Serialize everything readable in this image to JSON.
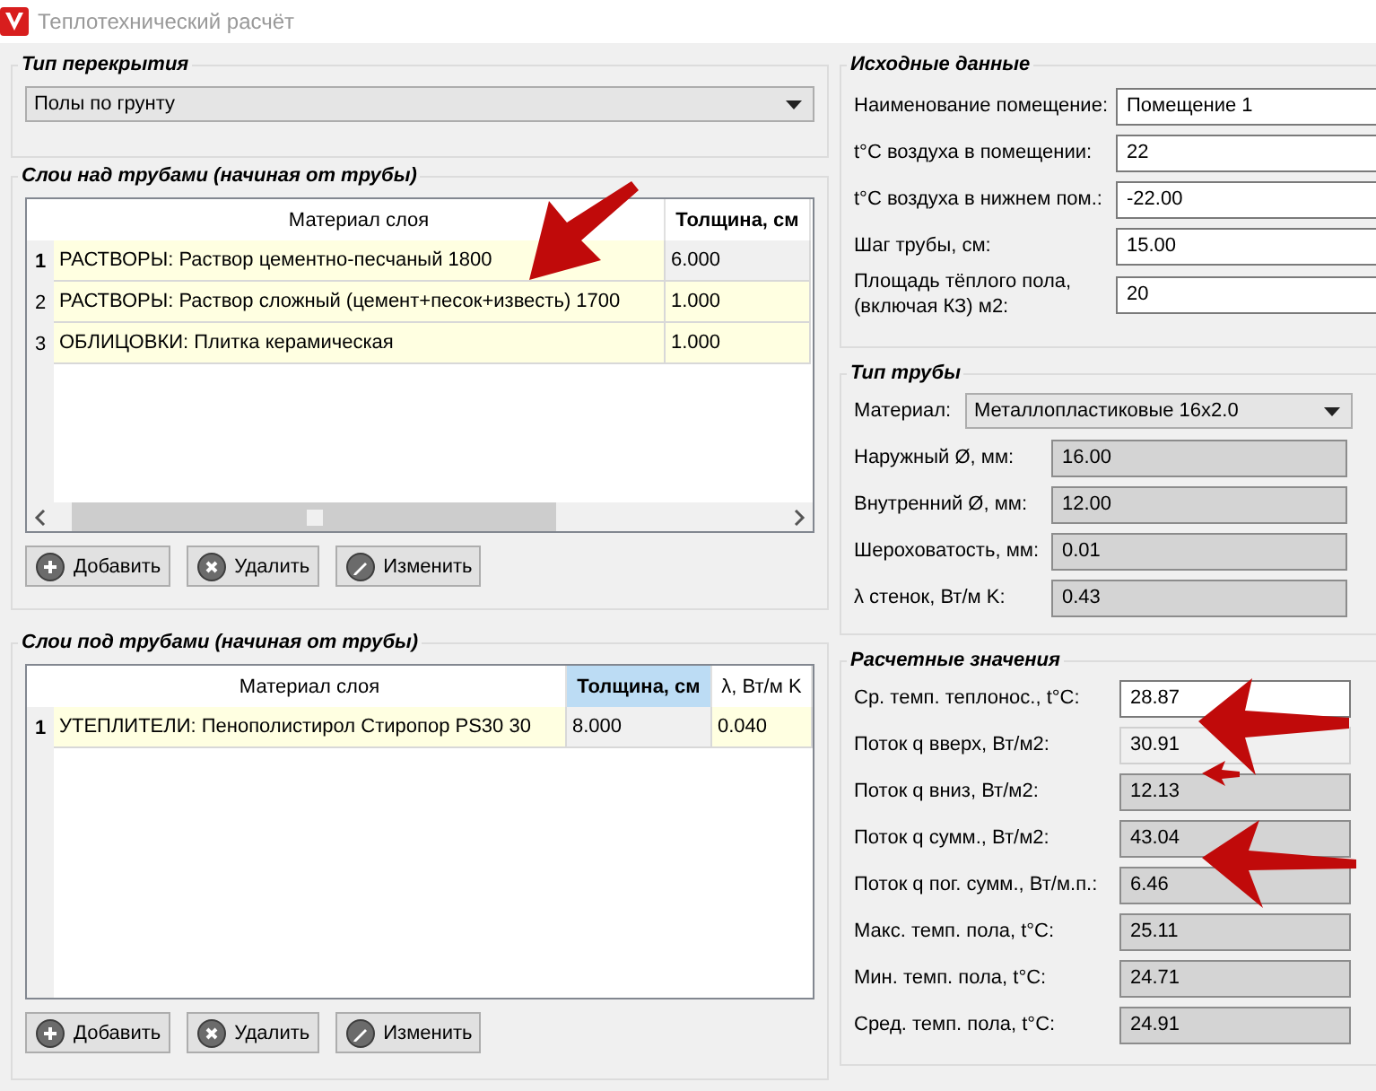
{
  "window": {
    "title": "Теплотехнический расчёт"
  },
  "floor_type": {
    "title": "Тип перекрытия",
    "value": "Полы по грунту"
  },
  "layers_above": {
    "title": "Слои над трубами (начиная от трубы)",
    "focused": false,
    "horizontal_scrollbar": true,
    "columns": [
      {
        "label": "Материал слоя",
        "selected": false
      },
      {
        "label": "Толщина, см",
        "selected": true
      }
    ],
    "rows": [
      {
        "number": "1",
        "selected": true,
        "cells": [
          "РАСТВОРЫ: Раствор цементно-песчаный 1800",
          "6.000"
        ]
      },
      {
        "number": "2",
        "selected": false,
        "cells": [
          "РАСТВОРЫ: Раствор сложный (цемент+песок+известь) 1700",
          "1.000"
        ]
      },
      {
        "number": "3",
        "selected": false,
        "cells": [
          "ОБЛИЦОВКИ: Плитка керамическая",
          "1.000"
        ]
      }
    ],
    "buttons": [
      {
        "kind": "add",
        "label": "Добавить"
      },
      {
        "kind": "delete",
        "label": "Удалить"
      },
      {
        "kind": "edit",
        "label": "Изменить"
      }
    ]
  },
  "layers_below": {
    "title": "Слои под трубами (начиная от трубы)",
    "focused": true,
    "horizontal_scrollbar": false,
    "columns": [
      {
        "label": "Материал слоя",
        "selected": false
      },
      {
        "label": "Толщина, см",
        "selected": true
      },
      {
        "label": "λ, Вт/м K",
        "selected": false
      }
    ],
    "rows": [
      {
        "number": "1",
        "selected": true,
        "cells": [
          "УТЕПЛИТЕЛИ: Пенополистирол Стиропор PS30 30",
          "8.000",
          "0.040"
        ]
      }
    ],
    "buttons": [
      {
        "kind": "add",
        "label": "Добавить"
      },
      {
        "kind": "delete",
        "label": "Удалить"
      },
      {
        "kind": "edit",
        "label": "Изменить"
      }
    ]
  },
  "source_data": {
    "title": "Исходные данные",
    "fields": [
      {
        "label": "Наименование помещение:",
        "value": "Помещение 1",
        "kind": "input"
      },
      {
        "label": "t°C воздуха в помещении:",
        "value": "22",
        "kind": "input"
      },
      {
        "label": "t°C воздуха в нижнем пом.:",
        "value": "-22.00",
        "kind": "input"
      },
      {
        "label": "Шаг трубы, см:",
        "value": "15.00",
        "kind": "input"
      },
      {
        "label": "Площадь тёплого пола, (включая КЗ) м2:",
        "value": "20",
        "kind": "input"
      }
    ]
  },
  "pipe_type": {
    "title": "Тип трубы",
    "material": {
      "label": "Материал:",
      "value": "Металлопластиковые 16x2.0"
    },
    "fields": [
      {
        "label": "Наружный Ø, мм:",
        "value": "16.00",
        "kind": "output"
      },
      {
        "label": "Внутренний Ø, мм:",
        "value": "12.00",
        "kind": "output"
      },
      {
        "label": "Шероховатость, мм:",
        "value": "0.01",
        "kind": "output"
      },
      {
        "label": "λ стенок, Вт/м K:",
        "value": "0.43",
        "kind": "output"
      }
    ]
  },
  "results": {
    "title": "Расчетные значения",
    "fields": [
      {
        "label": "Ср. темп. теплонос., t°C:",
        "value": "28.87",
        "kind": "input"
      },
      {
        "label": "Поток q вверх, Вт/м2:",
        "value": "30.91",
        "kind": "plain"
      },
      {
        "label": "Поток q вниз, Вт/м2:",
        "value": "12.13",
        "kind": "output"
      },
      {
        "label": "Поток q сумм., Вт/м2:",
        "value": "43.04",
        "kind": "output"
      },
      {
        "label": "Поток q пог. сумм., Вт/м.п.:",
        "value": "6.46",
        "kind": "output"
      },
      {
        "label": "Макс. темп. пола, t°C:",
        "value": "25.11",
        "kind": "output"
      },
      {
        "label": "Мин. темп. пола, t°C:",
        "value": "24.71",
        "kind": "output"
      },
      {
        "label": "Сред. темп. пола, t°C:",
        "value": "24.91",
        "kind": "output"
      }
    ]
  }
}
